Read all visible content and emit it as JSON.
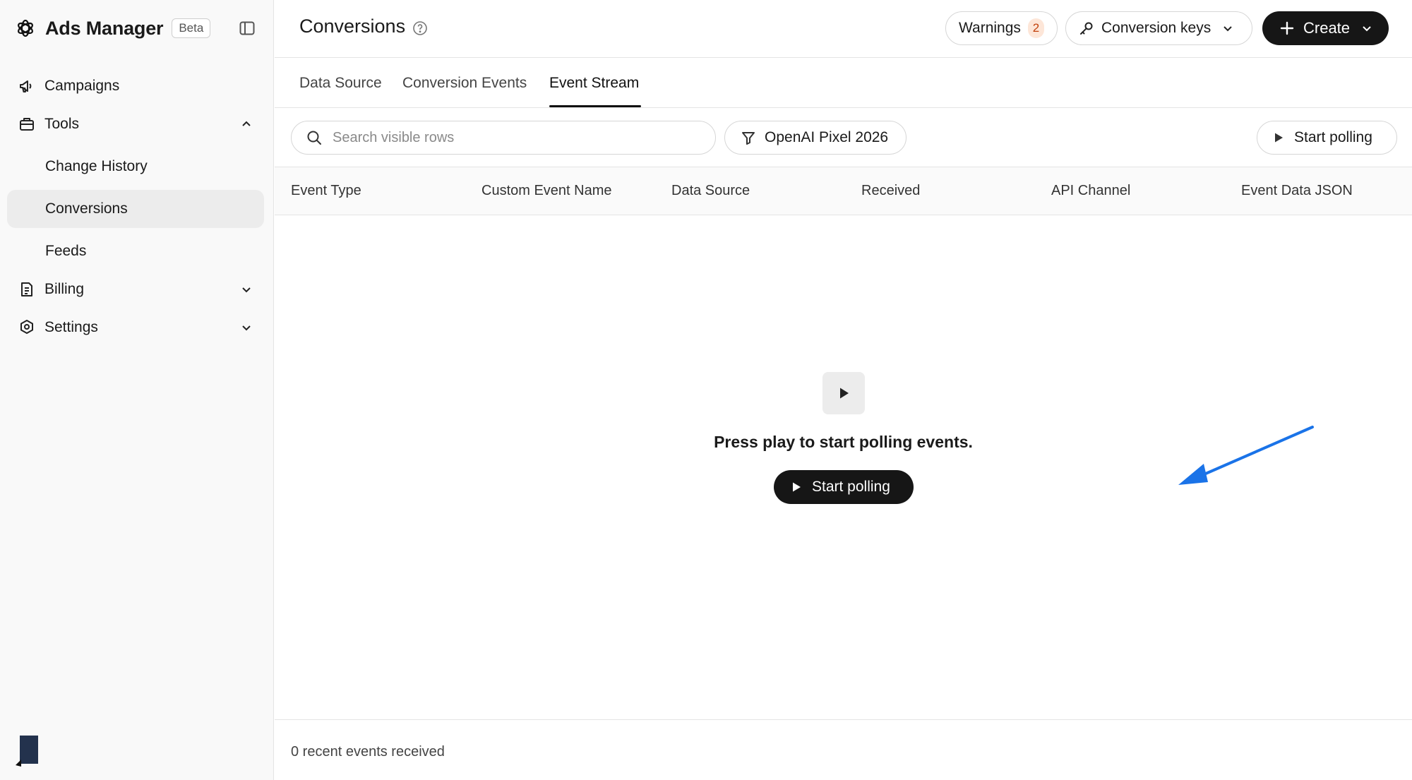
{
  "sidebar": {
    "brand": {
      "title": "Ads Manager",
      "badge": "Beta"
    },
    "items": [
      {
        "label": "Campaigns",
        "icon": "megaphone-icon"
      },
      {
        "label": "Tools",
        "icon": "toolbox-icon",
        "expanded": true
      },
      {
        "label": "Change History"
      },
      {
        "label": "Conversions",
        "active": true
      },
      {
        "label": "Feeds"
      },
      {
        "label": "Billing",
        "icon": "billing-icon",
        "expanded": false
      },
      {
        "label": "Settings",
        "icon": "gear-icon",
        "expanded": false
      }
    ]
  },
  "header": {
    "title": "Conversions",
    "warnings_label": "Warnings",
    "warnings_count": "2",
    "keys_label": "Conversion keys",
    "create_label": "Create"
  },
  "tabs": [
    {
      "label": "Data Source"
    },
    {
      "label": "Conversion Events"
    },
    {
      "label": "Event Stream",
      "active": true
    }
  ],
  "toolbar": {
    "search_placeholder": "Search visible rows",
    "filter_label": "OpenAI Pixel 2026",
    "poll_label": "Start polling"
  },
  "table": {
    "columns": [
      "Event Type",
      "Custom Event Name",
      "Data Source",
      "Received",
      "API Channel",
      "Event Data JSON"
    ]
  },
  "empty_state": {
    "message": "Press play to start polling events.",
    "button_label": "Start polling"
  },
  "footer": {
    "status": "0 recent events received"
  },
  "colors": {
    "accent_dark": "#161616",
    "arrow": "#1a73e8",
    "badge_bg": "#fde6d8",
    "badge_text": "#c2410c"
  }
}
